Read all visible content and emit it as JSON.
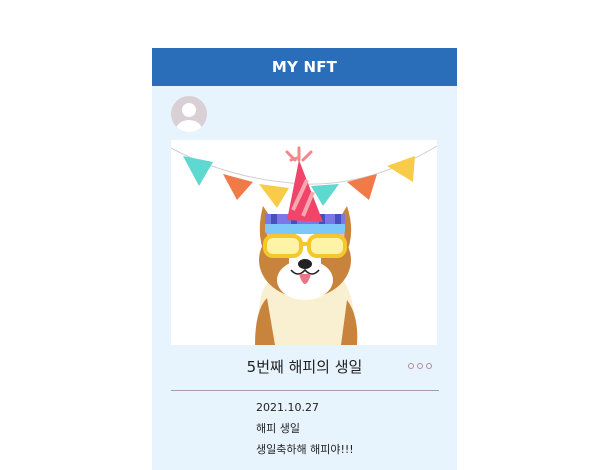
{
  "header": {
    "title": "MY NFT",
    "bg_color": "#2a6db8"
  },
  "nft": {
    "image_icon": "birthday-dog-illustration",
    "title": "5번째 해피의 생일",
    "more_icon": "more-dots-icon",
    "date": "2021.10.27",
    "name": "해피 생일",
    "description": "생일축하해 해피야!!!"
  },
  "colors": {
    "panel": "#e8f4fd",
    "accent": "#2a6db8",
    "dog_orange": "#c8843c",
    "dog_cream": "#f8f0d0"
  }
}
